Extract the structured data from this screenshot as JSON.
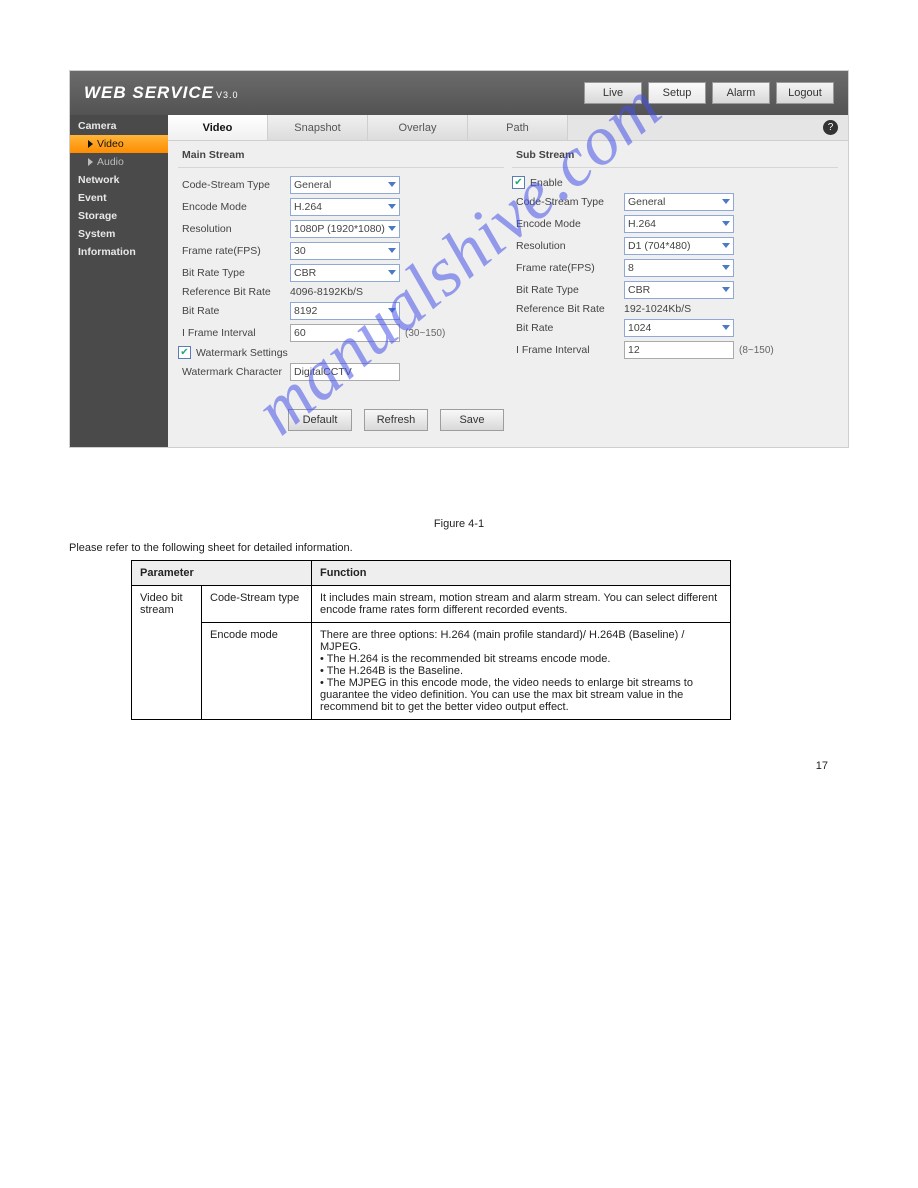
{
  "header": {
    "logo_main": "WEB  SERVICE",
    "logo_sub": "V3.0"
  },
  "topnav": {
    "live": "Live",
    "setup": "Setup",
    "alarm": "Alarm",
    "logout": "Logout"
  },
  "sidebar": {
    "camera": "Camera",
    "video": "Video",
    "audio": "Audio",
    "network": "Network",
    "event": "Event",
    "storage": "Storage",
    "system": "System",
    "information": "Information"
  },
  "tabs": {
    "video": "Video",
    "snapshot": "Snapshot",
    "overlay": "Overlay",
    "path": "Path"
  },
  "main": {
    "title": "Main Stream",
    "code_stream_type_label": "Code-Stream Type",
    "code_stream_type": "General",
    "encode_mode_label": "Encode Mode",
    "encode_mode": "H.264",
    "resolution_label": "Resolution",
    "resolution": "1080P (1920*1080)",
    "framerate_label": "Frame rate(FPS)",
    "framerate": "30",
    "bitrate_type_label": "Bit Rate Type",
    "bitrate_type": "CBR",
    "ref_bitrate_label": "Reference Bit Rate",
    "ref_bitrate": "4096-8192Kb/S",
    "bitrate_label": "Bit Rate",
    "bitrate": "8192",
    "iframe_label": "I Frame Interval",
    "iframe": "60",
    "iframe_range": "(30~150)",
    "watermark_check_label": "Watermark Settings",
    "watermark_char_label": "Watermark Character",
    "watermark_char": "DigitalCCTV"
  },
  "sub": {
    "title": "Sub Stream",
    "enable_label": "Enable",
    "code_stream_type_label": "Code-Stream Type",
    "code_stream_type": "General",
    "encode_mode_label": "Encode Mode",
    "encode_mode": "H.264",
    "resolution_label": "Resolution",
    "resolution": "D1 (704*480)",
    "framerate_label": "Frame rate(FPS)",
    "framerate": "8",
    "bitrate_type_label": "Bit Rate Type",
    "bitrate_type": "CBR",
    "ref_bitrate_label": "Reference Bit Rate",
    "ref_bitrate": "192-1024Kb/S",
    "bitrate_label": "Bit Rate",
    "bitrate": "1024",
    "iframe_label": "I Frame Interval",
    "iframe": "12",
    "iframe_range": "(8~150)"
  },
  "actions": {
    "default": "Default",
    "refresh": "Refresh",
    "save": "Save"
  },
  "help_glyph": "?",
  "watermark_text": "manualshive.com",
  "manual": {
    "figcap": "Figure 4-1",
    "lead": "Please refer to the following sheet for detailed information.",
    "th_param": "Parameter",
    "th_func": "Function",
    "row1_c1": "Video bit stream",
    "row1_c2": "Code-Stream type",
    "row1_c3": "It includes main stream, motion stream and alarm stream. You can select different encode frame rates form different recorded events.",
    "row2_c2": "Encode mode",
    "row2_c3a": "There are three options: H.264 (main profile standard)/ H.264B (Baseline) / MJPEG.",
    "row2_c3b": "• The H.264 is the recommended bit streams encode mode.",
    "row2_c3c": "• The H.264B is the Baseline.",
    "row2_c3d": "• The MJPEG in this encode mode, the video needs to enlarge bit streams to guarantee the video definition. You can use the max bit stream value in the recommend bit to get the better video output effect.",
    "page_num": "17"
  }
}
